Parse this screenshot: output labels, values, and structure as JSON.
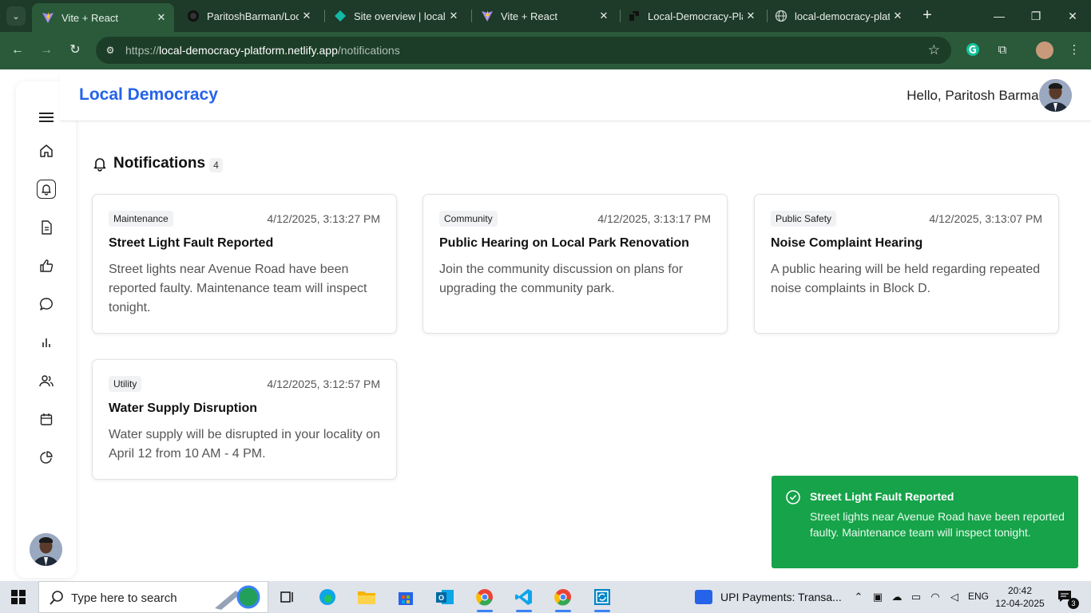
{
  "browser": {
    "tabs": [
      {
        "title": "Vite + React",
        "icon": "vite-icon",
        "active": true
      },
      {
        "title": "ParitoshBarman/Local",
        "icon": "github-icon",
        "active": false
      },
      {
        "title": "Site overview | local-d",
        "icon": "netlify-icon",
        "active": false
      },
      {
        "title": "Vite + React",
        "icon": "vite-icon",
        "active": false
      },
      {
        "title": "Local-Democracy-Pla",
        "icon": "render-icon",
        "active": false
      },
      {
        "title": "local-democracy-platf",
        "icon": "globe-icon",
        "active": false
      }
    ],
    "url_prefix": "https://",
    "url_host": "local-democracy-platform.netlify.app",
    "url_path": "/notifications"
  },
  "app": {
    "brand": "Local Democracy",
    "greeting": "Hello, Paritosh Barman",
    "sidebar_items": [
      "menu-icon",
      "home-icon",
      "bell-icon",
      "document-icon",
      "thumbs-up-icon",
      "chat-icon",
      "bar-chart-icon",
      "users-icon",
      "calendar-icon",
      "pie-chart-icon"
    ],
    "active_sidebar_item": "bell-icon"
  },
  "notifications": {
    "heading": "Notifications",
    "count": "4",
    "items": [
      {
        "category": "Maintenance",
        "time": "4/12/2025, 3:13:27 PM",
        "title": "Street Light Fault Reported",
        "body": "Street lights near Avenue Road have been reported faulty. Maintenance team will inspect tonight."
      },
      {
        "category": "Community",
        "time": "4/12/2025, 3:13:17 PM",
        "title": "Public Hearing on Local Park Renovation",
        "body": "Join the community discussion on plans for upgrading the community park."
      },
      {
        "category": "Public Safety",
        "time": "4/12/2025, 3:13:07 PM",
        "title": "Noise Complaint Hearing",
        "body": "A public hearing will be held regarding repeated noise complaints in Block D."
      },
      {
        "category": "Utility",
        "time": "4/12/2025, 3:12:57 PM",
        "title": "Water Supply Disruption",
        "body": "Water supply will be disrupted in your locality on April 12 from 10 AM - 4 PM."
      }
    ]
  },
  "toast": {
    "title": "Street Light Fault Reported",
    "body": "Street lights near Avenue Road have been reported faulty. Maintenance team will inspect tonight.",
    "color": "#16a34a"
  },
  "taskbar": {
    "search_placeholder": "Type here to search",
    "pinned_window": "UPI Payments: Transa...",
    "language": "ENG",
    "time": "20:42",
    "date": "12-04-2025",
    "notification_count": "3"
  },
  "colors": {
    "brand": "#2563eb",
    "browser_frame": "#1e3a28",
    "toolbar": "#2a5a3a"
  }
}
